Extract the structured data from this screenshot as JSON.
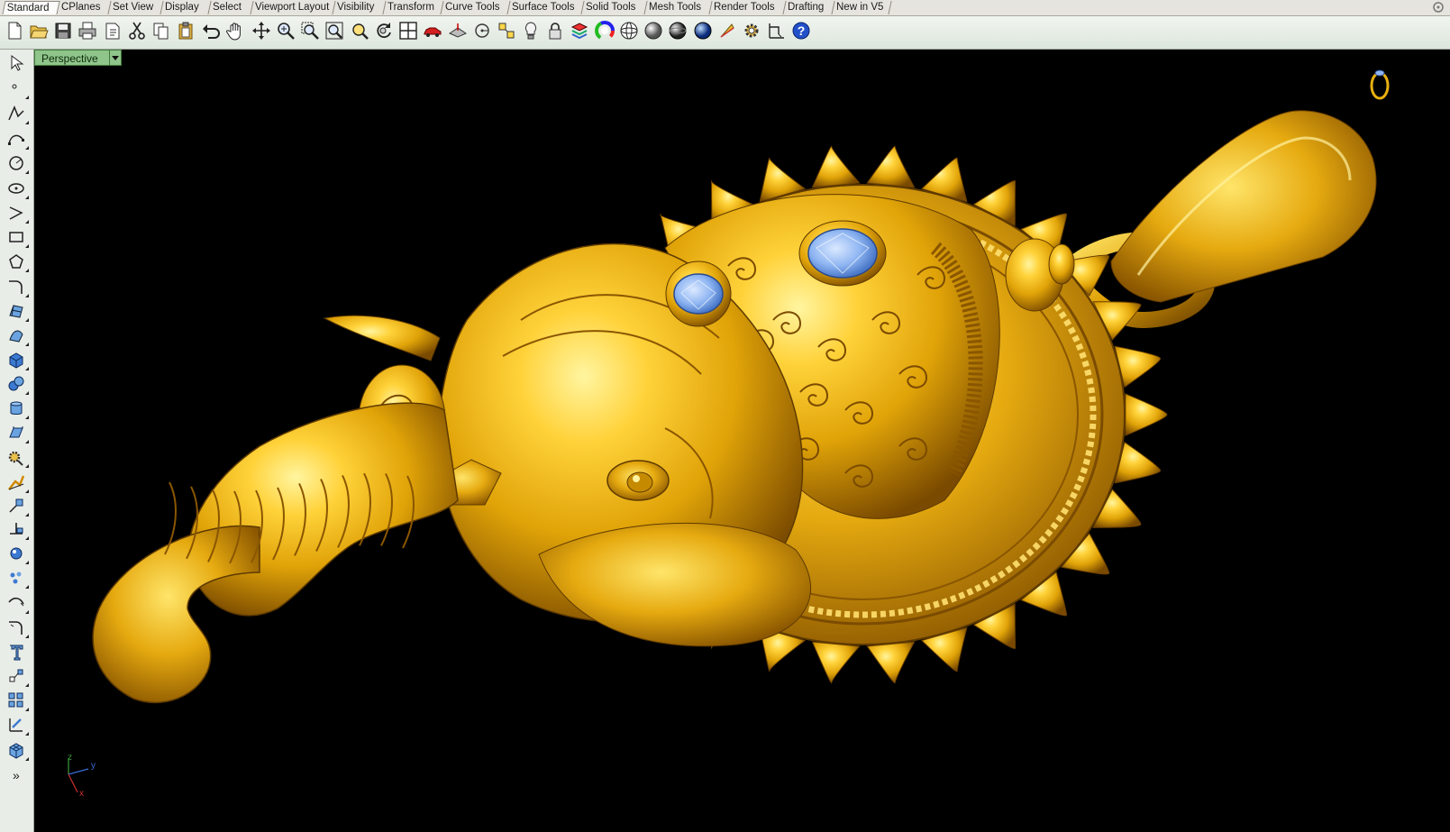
{
  "tabs": [
    {
      "label": "Standard",
      "active": true
    },
    {
      "label": "CPlanes"
    },
    {
      "label": "Set View"
    },
    {
      "label": "Display"
    },
    {
      "label": "Select"
    },
    {
      "label": "Viewport Layout"
    },
    {
      "label": "Visibility"
    },
    {
      "label": "Transform"
    },
    {
      "label": "Curve Tools"
    },
    {
      "label": "Surface Tools"
    },
    {
      "label": "Solid Tools"
    },
    {
      "label": "Mesh Tools"
    },
    {
      "label": "Render Tools"
    },
    {
      "label": "Drafting"
    },
    {
      "label": "New in V5"
    }
  ],
  "toolbar_icons": [
    "new-icon",
    "open-icon",
    "save-icon",
    "print-icon",
    "import-icon",
    "cut-icon",
    "copy-icon",
    "paste-icon",
    "undo-icon",
    "pan-icon",
    "rotate-view-icon",
    "zoom-icon",
    "zoom-window-icon",
    "zoom-extents-icon",
    "zoom-selected-icon",
    "undo-view-icon",
    "four-viewports-icon",
    "car-icon",
    "plane-icon",
    "circle-dot-icon",
    "grid-snap-icon",
    "light-bulb-icon",
    "lock-icon",
    "layers-icon",
    "color-wheel-icon",
    "sphere-wireframe-icon",
    "sphere-shaded-icon",
    "sphere-rendered-icon",
    "sphere-blue-icon",
    "render-icon",
    "options-gear-icon",
    "dimension-icon",
    "help-icon"
  ],
  "left_tools": [
    "select-arrow-icon",
    "point-icon",
    "polyline-icon",
    "curve-icon",
    "circle-icon",
    "ellipse-icon",
    "arc-icon",
    "rectangle-icon",
    "polygon-icon",
    "fillet-curve-icon",
    "surface-icon",
    "loft-icon",
    "box-icon",
    "sphere-icon",
    "cylinder-icon",
    "extrude-icon",
    "edit-gear-icon",
    "boolean-icon",
    "transform-icon",
    "split-icon",
    "explode-icon",
    "point-cloud-icon",
    "curve-offset-icon",
    "fillet-icon",
    "text-icon",
    "analyze-icon",
    "array-icon",
    "dimension-tool-icon",
    "mesh-icon"
  ],
  "left_more": "»",
  "viewport": {
    "label": "Perspective",
    "axes": {
      "x": "x",
      "y": "y",
      "z": "z"
    },
    "colors": {
      "background": "#000000",
      "gold": "#e8b010",
      "gem": "#8eb5f2",
      "label_bg": "#8fc48a"
    }
  }
}
